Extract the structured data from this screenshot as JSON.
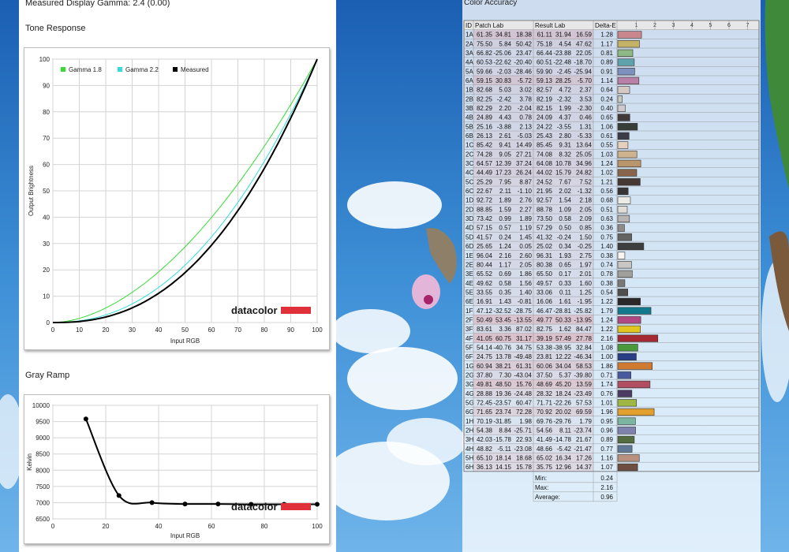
{
  "header": {
    "measured_gamma": "Measured Display Gamma: 2.4 (0.00)"
  },
  "tone_chart": {
    "section_title": "Tone Response",
    "logo": "datacolor",
    "chart_data": {
      "type": "line",
      "xlabel": "Input RGB",
      "ylabel": "Output Brightness",
      "xlim": [
        0,
        100
      ],
      "ylim": [
        0,
        100
      ],
      "xticks": [
        0,
        10,
        20,
        30,
        40,
        50,
        60,
        70,
        80,
        90,
        100
      ],
      "yticks": [
        0,
        10,
        20,
        30,
        40,
        50,
        60,
        70,
        80,
        90,
        100
      ],
      "grid": true,
      "legend": "top-left",
      "series": [
        {
          "name": "Gamma 1.8",
          "color": "#33dd33",
          "gamma": 1.8
        },
        {
          "name": "Gamma 2.2",
          "color": "#33dddd",
          "gamma": 2.2
        },
        {
          "name": "Measured",
          "color": "#000000",
          "gamma": 2.4
        }
      ]
    }
  },
  "gray_chart": {
    "section_title": "Gray Ramp",
    "logo": "datacolor",
    "chart_data": {
      "type": "line",
      "xlabel": "Input RGB",
      "ylabel": "Kelvin",
      "xlim": [
        0,
        100
      ],
      "ylim": [
        6500,
        10000
      ],
      "xticks": [
        0,
        20,
        40,
        60,
        80,
        100
      ],
      "yticks": [
        6500,
        7000,
        7500,
        8000,
        8500,
        9000,
        9500,
        10000
      ],
      "grid": true,
      "x": [
        12.5,
        25,
        37.5,
        50,
        62.5,
        75,
        87.5,
        100
      ],
      "values": [
        9580,
        7220,
        7000,
        6960,
        6960,
        6950,
        6950,
        6950
      ]
    }
  },
  "color_accuracy": {
    "title": "Color Accuracy",
    "headers": {
      "id": "ID",
      "patch": "Patch Lab",
      "result": "Result Lab",
      "de": "Delta-E"
    },
    "scale_ticks": [
      "1",
      "2",
      "3",
      "4",
      "5",
      "6",
      "7"
    ],
    "rows": [
      {
        "id": "1A",
        "patch": [
          "61.35",
          "34.81",
          "18.38"
        ],
        "result": [
          "61.11",
          "31.94",
          "16.59"
        ],
        "de": "1.28",
        "color": "#c9868c"
      },
      {
        "id": "2A",
        "patch": [
          "75.50",
          "5.84",
          "50.42"
        ],
        "result": [
          "75.18",
          "4.54",
          "47.62"
        ],
        "de": "1.17",
        "color": "#c4b366"
      },
      {
        "id": "3A",
        "patch": [
          "66.82",
          "-25.06",
          "23.47"
        ],
        "result": [
          "66.44",
          "-23.88",
          "22.05"
        ],
        "de": "0.81",
        "color": "#8db784"
      },
      {
        "id": "4A",
        "patch": [
          "60.53",
          "-22.62",
          "-20.40"
        ],
        "result": [
          "60.51",
          "-22.48",
          "-18.70"
        ],
        "de": "0.89",
        "color": "#5ea2ac"
      },
      {
        "id": "5A",
        "patch": [
          "59.66",
          "-2.03",
          "-28.46"
        ],
        "result": [
          "59.90",
          "-2.45",
          "-25.94"
        ],
        "de": "0.91",
        "color": "#7e90bd"
      },
      {
        "id": "6A",
        "patch": [
          "59.15",
          "30.83",
          "-5.72"
        ],
        "result": [
          "59.13",
          "28.25",
          "-5.70"
        ],
        "de": "1.14",
        "color": "#b880a6"
      },
      {
        "id": "1B",
        "patch": [
          "82.68",
          "5.03",
          "3.02"
        ],
        "result": [
          "82.57",
          "4.72",
          "2.37"
        ],
        "de": "0.64",
        "color": "#d6c8c3"
      },
      {
        "id": "2B",
        "patch": [
          "82.25",
          "-2.42",
          "3.78"
        ],
        "result": [
          "82.19",
          "-2.32",
          "3.53"
        ],
        "de": "0.24",
        "color": "#c7cbc0"
      },
      {
        "id": "3B",
        "patch": [
          "82.29",
          "2.20",
          "-2.04"
        ],
        "result": [
          "82.15",
          "1.99",
          "-2.30"
        ],
        "de": "0.40",
        "color": "#cec9cc"
      },
      {
        "id": "4B",
        "patch": [
          "24.89",
          "4.43",
          "0.78"
        ],
        "result": [
          "24.09",
          "4.37",
          "0.46"
        ],
        "de": "0.65",
        "color": "#403a3a"
      },
      {
        "id": "5B",
        "patch": [
          "25.16",
          "-3.88",
          "2.13"
        ],
        "result": [
          "24.22",
          "-3.55",
          "1.31"
        ],
        "de": "1.06",
        "color": "#363e37"
      },
      {
        "id": "6B",
        "patch": [
          "26.13",
          "2.61",
          "-5.03"
        ],
        "result": [
          "25.43",
          "2.80",
          "-5.33"
        ],
        "de": "0.61",
        "color": "#3c3c47"
      },
      {
        "id": "1C",
        "patch": [
          "85.42",
          "9.41",
          "14.49"
        ],
        "result": [
          "85.45",
          "9.31",
          "13.64"
        ],
        "de": "0.55",
        "color": "#e7cfbe"
      },
      {
        "id": "2C",
        "patch": [
          "74.28",
          "9.05",
          "27.21"
        ],
        "result": [
          "74.08",
          "8.32",
          "25.05"
        ],
        "de": "1.03",
        "color": "#cfb38e"
      },
      {
        "id": "3C",
        "patch": [
          "64.57",
          "12.39",
          "37.24"
        ],
        "result": [
          "64.08",
          "10.78",
          "34.96"
        ],
        "de": "1.24",
        "color": "#b9956b"
      },
      {
        "id": "4C",
        "patch": [
          "44.49",
          "17.23",
          "26.24"
        ],
        "result": [
          "44.02",
          "15.79",
          "24.82"
        ],
        "de": "1.02",
        "color": "#87644a"
      },
      {
        "id": "5C",
        "patch": [
          "25.29",
          "7.95",
          "8.87"
        ],
        "result": [
          "24.52",
          "7.67",
          "7.52"
        ],
        "de": "1.21",
        "color": "#463832"
      },
      {
        "id": "6C",
        "patch": [
          "22.67",
          "2.11",
          "-1.10"
        ],
        "result": [
          "21.95",
          "2.02",
          "-1.32"
        ],
        "de": "0.56",
        "color": "#383537"
      },
      {
        "id": "1D",
        "patch": [
          "92.72",
          "1.89",
          "2.76"
        ],
        "result": [
          "92.57",
          "1.54",
          "2.18"
        ],
        "de": "0.68",
        "color": "#eceae5"
      },
      {
        "id": "2D",
        "patch": [
          "88.85",
          "1.59",
          "2.27"
        ],
        "result": [
          "88.78",
          "1.09",
          "2.05"
        ],
        "de": "0.51",
        "color": "#e0dcd8"
      },
      {
        "id": "3D",
        "patch": [
          "73.42",
          "0.99",
          "1.89"
        ],
        "result": [
          "73.50",
          "0.58",
          "2.09"
        ],
        "de": "0.63",
        "color": "#b7b4b1"
      },
      {
        "id": "4D",
        "patch": [
          "57.15",
          "0.57",
          "1.19"
        ],
        "result": [
          "57.29",
          "0.50",
          "0.85"
        ],
        "de": "0.36",
        "color": "#8d8b89"
      },
      {
        "id": "5D",
        "patch": [
          "41.57",
          "0.24",
          "1.45"
        ],
        "result": [
          "41.32",
          "-0.24",
          "1.50"
        ],
        "de": "0.75",
        "color": "#646463"
      },
      {
        "id": "6D",
        "patch": [
          "25.65",
          "1.24",
          "0.05"
        ],
        "result": [
          "25.02",
          "0.34",
          "-0.25"
        ],
        "de": "1.40",
        "color": "#3e3e3e"
      },
      {
        "id": "1E",
        "patch": [
          "96.04",
          "2.16",
          "2.60"
        ],
        "result": [
          "96.31",
          "1.93",
          "2.75"
        ],
        "de": "0.38",
        "color": "#f7f4f1"
      },
      {
        "id": "2E",
        "patch": [
          "80.44",
          "1.17",
          "2.05"
        ],
        "result": [
          "80.38",
          "0.65",
          "1.97"
        ],
        "de": "0.74",
        "color": "#cac6c3"
      },
      {
        "id": "3E",
        "patch": [
          "65.52",
          "0.69",
          "1.86"
        ],
        "result": [
          "65.50",
          "0.17",
          "2.01"
        ],
        "de": "0.78",
        "color": "#a19f9c"
      },
      {
        "id": "4E",
        "patch": [
          "49.62",
          "0.58",
          "1.56"
        ],
        "result": [
          "49.57",
          "0.33",
          "1.60"
        ],
        "de": "0.38",
        "color": "#797877"
      },
      {
        "id": "5E",
        "patch": [
          "33.55",
          "0.35",
          "1.40"
        ],
        "result": [
          "33.06",
          "0.11",
          "1.25"
        ],
        "de": "0.54",
        "color": "#504f4e"
      },
      {
        "id": "6E",
        "patch": [
          "16.91",
          "1.43",
          "-0.81"
        ],
        "result": [
          "16.06",
          "1.61",
          "-1.95"
        ],
        "de": "1.22",
        "color": "#292729"
      },
      {
        "id": "1F",
        "patch": [
          "47.12",
          "-32.52",
          "-28.75"
        ],
        "result": [
          "46.47",
          "-28.81",
          "-25.82"
        ],
        "de": "1.79",
        "color": "#12788c"
      },
      {
        "id": "2F",
        "patch": [
          "50.49",
          "53.45",
          "-13.55"
        ],
        "result": [
          "49.77",
          "50.33",
          "-13.95"
        ],
        "de": "1.24",
        "color": "#b14883"
      },
      {
        "id": "3F",
        "patch": [
          "83.61",
          "3.36",
          "87.02"
        ],
        "result": [
          "82.75",
          "1.62",
          "84.47"
        ],
        "de": "1.22",
        "color": "#e2c61f"
      },
      {
        "id": "4F",
        "patch": [
          "41.05",
          "60.75",
          "31.17"
        ],
        "result": [
          "39.19",
          "57.49",
          "27.78"
        ],
        "de": "2.16",
        "color": "#a62833"
      },
      {
        "id": "5F",
        "patch": [
          "54.14",
          "-40.76",
          "34.75"
        ],
        "result": [
          "53.38",
          "-38.95",
          "32.84"
        ],
        "de": "1.08",
        "color": "#4a9a3c"
      },
      {
        "id": "6F",
        "patch": [
          "24.75",
          "13.78",
          "-49.48"
        ],
        "result": [
          "23.81",
          "12.22",
          "-46.34"
        ],
        "de": "1.00",
        "color": "#283f85"
      },
      {
        "id": "1G",
        "patch": [
          "60.94",
          "38.21",
          "61.31"
        ],
        "result": [
          "60.06",
          "34.04",
          "58.53"
        ],
        "de": "1.86",
        "color": "#d07930"
      },
      {
        "id": "2G",
        "patch": [
          "37.80",
          "7.30",
          "-43.04"
        ],
        "result": [
          "37.50",
          "5.37",
          "-39.80"
        ],
        "de": "0.71",
        "color": "#4959a0"
      },
      {
        "id": "3G",
        "patch": [
          "49.81",
          "48.50",
          "15.76"
        ],
        "result": [
          "48.69",
          "45.20",
          "13.59"
        ],
        "de": "1.74",
        "color": "#b24e61"
      },
      {
        "id": "4G",
        "patch": [
          "28.88",
          "19.36",
          "-24.48"
        ],
        "result": [
          "28.32",
          "18.24",
          "-23.49"
        ],
        "de": "0.76",
        "color": "#4c3a63"
      },
      {
        "id": "5G",
        "patch": [
          "72.45",
          "-23.57",
          "60.47"
        ],
        "result": [
          "71.71",
          "-22.26",
          "57.53"
        ],
        "de": "1.01",
        "color": "#9fb843"
      },
      {
        "id": "6G",
        "patch": [
          "71.65",
          "23.74",
          "72.28"
        ],
        "result": [
          "70.92",
          "20.02",
          "69.59"
        ],
        "de": "1.96",
        "color": "#e19f2e"
      },
      {
        "id": "1H",
        "patch": [
          "70.19",
          "-31.85",
          "1.98"
        ],
        "result": [
          "69.76",
          "-29.76",
          "1.79"
        ],
        "de": "0.95",
        "color": "#7bb49f"
      },
      {
        "id": "2H",
        "patch": [
          "54.38",
          "8.84",
          "-25.71"
        ],
        "result": [
          "54.56",
          "8.11",
          "-23.74"
        ],
        "de": "0.96",
        "color": "#7f82ae"
      },
      {
        "id": "3H",
        "patch": [
          "42.03",
          "-15.78",
          "22.93"
        ],
        "result": [
          "41.49",
          "-14.78",
          "21.67"
        ],
        "de": "0.89",
        "color": "#546c3f"
      },
      {
        "id": "4H",
        "patch": [
          "48.82",
          "-5.11",
          "-23.08"
        ],
        "result": [
          "48.66",
          "-5.42",
          "-21.47"
        ],
        "de": "0.77",
        "color": "#5f7896"
      },
      {
        "id": "5H",
        "patch": [
          "65.10",
          "18.14",
          "18.68"
        ],
        "result": [
          "65.02",
          "16.34",
          "17.26"
        ],
        "de": "1.16",
        "color": "#b8907d"
      },
      {
        "id": "6H",
        "patch": [
          "36.13",
          "14.15",
          "15.78"
        ],
        "result": [
          "35.75",
          "12.96",
          "14.37"
        ],
        "de": "1.07",
        "color": "#6d4e41"
      }
    ],
    "summary": [
      {
        "label": "Min:",
        "value": "0.24"
      },
      {
        "label": "Max:",
        "value": "2.16"
      },
      {
        "label": "Average:",
        "value": "0.96"
      }
    ]
  }
}
